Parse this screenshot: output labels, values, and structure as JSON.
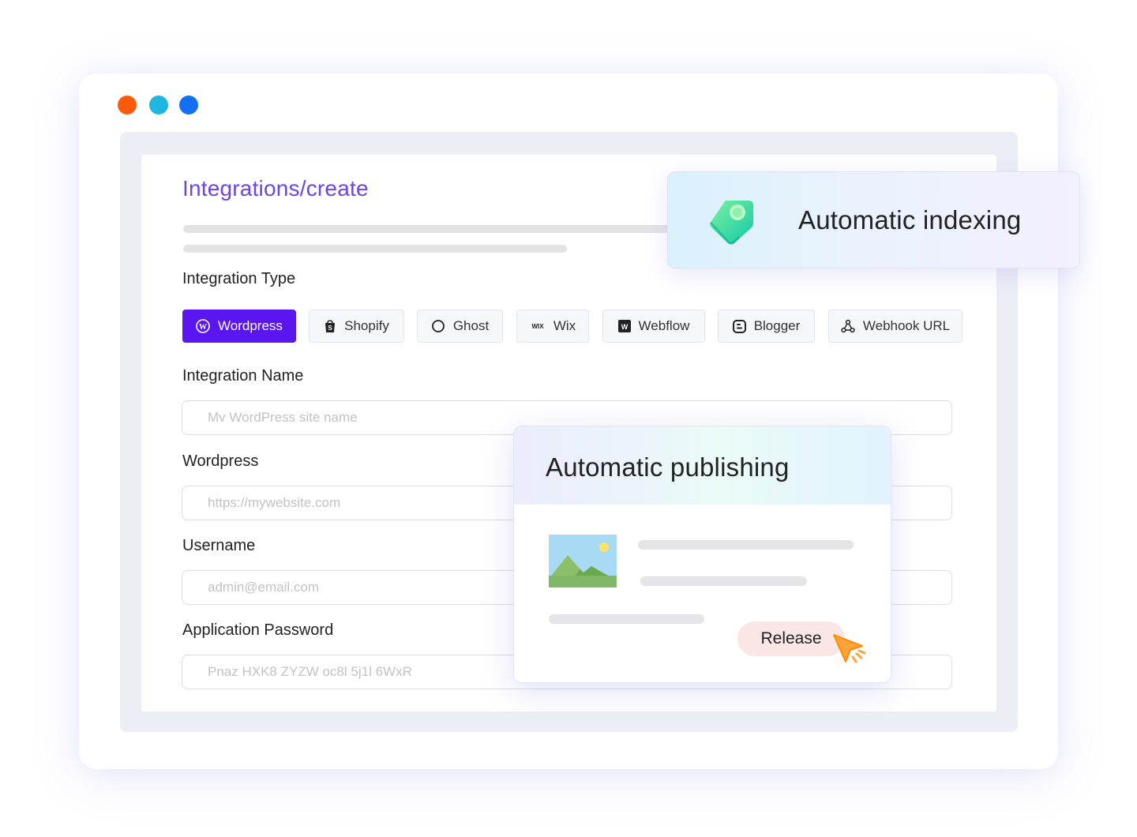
{
  "window": {
    "dots": [
      "red",
      "cyan",
      "blue"
    ]
  },
  "page": {
    "title": "Integrations/create"
  },
  "form": {
    "type_label": "Integration Type",
    "types": [
      {
        "label": "Wordpress",
        "icon": "wordpress-icon",
        "active": true
      },
      {
        "label": "Shopify",
        "icon": "shopify-bag-icon",
        "active": false
      },
      {
        "label": "Ghost",
        "icon": "ghost-circle-icon",
        "active": false
      },
      {
        "label": "Wix",
        "icon": "wix-logo-icon",
        "active": false
      },
      {
        "label": "Webflow",
        "icon": "webflow-icon",
        "active": false
      },
      {
        "label": "Blogger",
        "icon": "blogger-icon",
        "active": false
      },
      {
        "label": "Webhook URL",
        "icon": "webhook-icon",
        "active": false
      }
    ],
    "name_label": "Integration Name",
    "name_placeholder": "Mv WordPress site name",
    "site_label": "Wordpress",
    "site_placeholder": "https://mywebsite.com",
    "username_label": "Username",
    "username_placeholder": "admin@email.com",
    "password_label": "Application Password",
    "password_placeholder": "Pnaz HXK8 ZYZW oc8l 5j1l 6WxR"
  },
  "index_card": {
    "title": "Automatic indexing",
    "icon": "tag-icon"
  },
  "publish_card": {
    "title": "Automatic publishing",
    "release_label": "Release",
    "image_icon": "image-placeholder-icon",
    "cursor_icon": "pointer-cursor-icon"
  },
  "colors": {
    "accent": "#6b45e8",
    "primary_button": "#5a16f0",
    "dot_red": "#ff5a0a",
    "dot_cyan": "#1fb6e0",
    "dot_blue": "#1370f3"
  }
}
